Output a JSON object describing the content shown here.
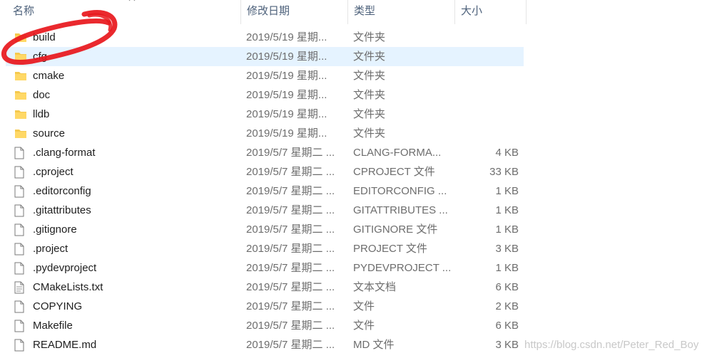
{
  "columns": {
    "name": "名称",
    "date": "修改日期",
    "type": "类型",
    "size": "大小"
  },
  "files": [
    {
      "name": "build",
      "date": "2019/5/19 星期...",
      "type": "文件夹",
      "size": "",
      "icon": "folder-icon",
      "selected": false
    },
    {
      "name": "cfg",
      "date": "2019/5/19 星期...",
      "type": "文件夹",
      "size": "",
      "icon": "folder-icon",
      "selected": true
    },
    {
      "name": "cmake",
      "date": "2019/5/19 星期...",
      "type": "文件夹",
      "size": "",
      "icon": "folder-icon",
      "selected": false
    },
    {
      "name": "doc",
      "date": "2019/5/19 星期...",
      "type": "文件夹",
      "size": "",
      "icon": "folder-icon",
      "selected": false
    },
    {
      "name": "lldb",
      "date": "2019/5/19 星期...",
      "type": "文件夹",
      "size": "",
      "icon": "folder-icon",
      "selected": false
    },
    {
      "name": "source",
      "date": "2019/5/19 星期...",
      "type": "文件夹",
      "size": "",
      "icon": "folder-icon",
      "selected": false
    },
    {
      "name": ".clang-format",
      "date": "2019/5/7 星期二 ...",
      "type": "CLANG-FORMA...",
      "size": "4 KB",
      "icon": "file-icon",
      "selected": false
    },
    {
      "name": ".cproject",
      "date": "2019/5/7 星期二 ...",
      "type": "CPROJECT 文件",
      "size": "33 KB",
      "icon": "file-icon",
      "selected": false
    },
    {
      "name": ".editorconfig",
      "date": "2019/5/7 星期二 ...",
      "type": "EDITORCONFIG ...",
      "size": "1 KB",
      "icon": "file-icon",
      "selected": false
    },
    {
      "name": ".gitattributes",
      "date": "2019/5/7 星期二 ...",
      "type": "GITATTRIBUTES ...",
      "size": "1 KB",
      "icon": "file-icon",
      "selected": false
    },
    {
      "name": ".gitignore",
      "date": "2019/5/7 星期二 ...",
      "type": "GITIGNORE 文件",
      "size": "1 KB",
      "icon": "file-icon",
      "selected": false
    },
    {
      "name": ".project",
      "date": "2019/5/7 星期二 ...",
      "type": "PROJECT 文件",
      "size": "3 KB",
      "icon": "file-icon",
      "selected": false
    },
    {
      "name": ".pydevproject",
      "date": "2019/5/7 星期二 ...",
      "type": "PYDEVPROJECT ...",
      "size": "1 KB",
      "icon": "file-icon",
      "selected": false
    },
    {
      "name": "CMakeLists.txt",
      "date": "2019/5/7 星期二 ...",
      "type": "文本文档",
      "size": "6 KB",
      "icon": "text-file-icon",
      "selected": false
    },
    {
      "name": "COPYING",
      "date": "2019/5/7 星期二 ...",
      "type": "文件",
      "size": "2 KB",
      "icon": "file-icon",
      "selected": false
    },
    {
      "name": "Makefile",
      "date": "2019/5/7 星期二 ...",
      "type": "文件",
      "size": "6 KB",
      "icon": "file-icon",
      "selected": false
    },
    {
      "name": "README.md",
      "date": "2019/5/7 星期二 ...",
      "type": "MD 文件",
      "size": "3 KB",
      "icon": "file-icon",
      "selected": false
    }
  ],
  "watermark": "https://blog.csdn.net/Peter_Red_Boy",
  "colors": {
    "selected_row": "#e5f3ff",
    "folder": "#f5c94e",
    "annotation": "#e8171c"
  }
}
